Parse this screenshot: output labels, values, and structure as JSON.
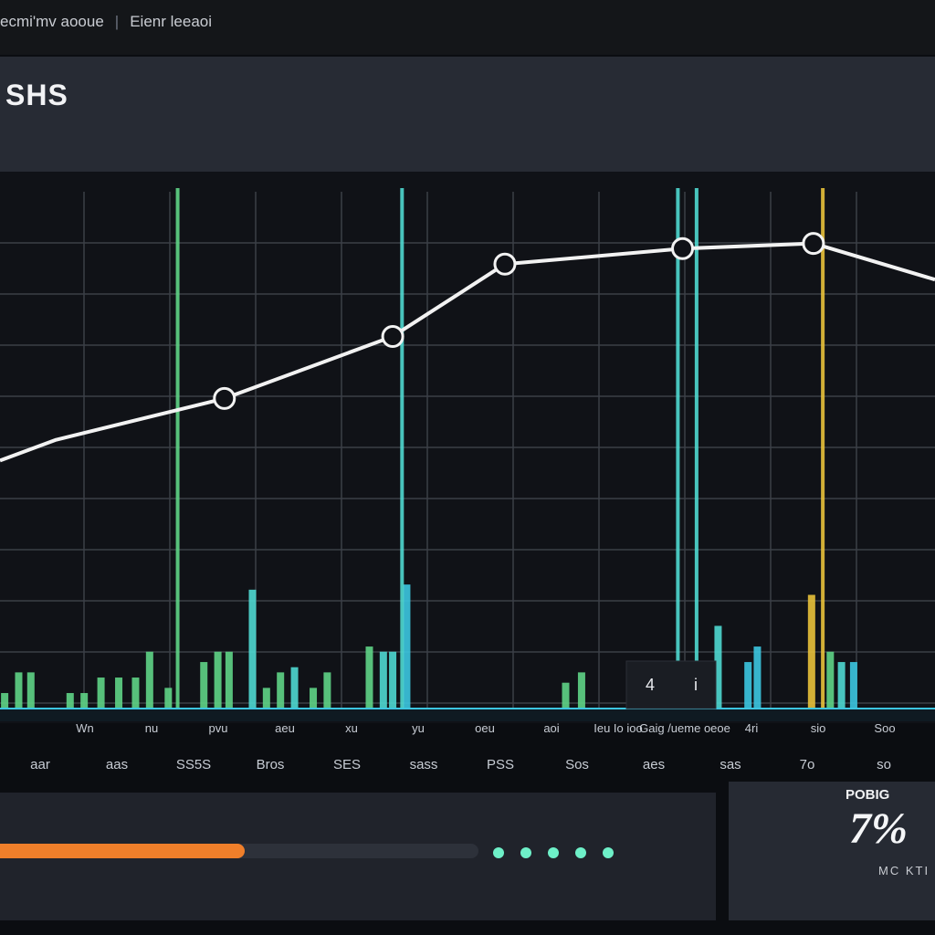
{
  "topbar": {
    "crumb_1": "ecmi'mv aooue",
    "crumb_2": "Eienr leeaoi",
    "separator": "|"
  },
  "header": {
    "title": "SHS"
  },
  "colors": {
    "line": "#f2f2f2",
    "green": "#5fd486",
    "teal": "#4fd8d0",
    "cyan": "#3cc6e0",
    "yellow": "#e8c13a",
    "grid": "#3b3f47",
    "accent_orange": "#f07f2a"
  },
  "chart_data": {
    "type": "line",
    "title": "",
    "xlabel": "",
    "ylabel": "",
    "grid": true,
    "xlim": [
      0,
      100
    ],
    "ylim": [
      0,
      100
    ],
    "series": [
      {
        "x": [
          0,
          6,
          24,
          42,
          54,
          73,
          87,
          100
        ],
        "values": [
          48,
          52,
          60,
          72,
          86,
          89,
          90,
          83
        ],
        "markers_at": [
          2,
          3,
          4,
          5,
          6
        ]
      }
    ],
    "vertical_markers": [
      {
        "x": 19,
        "color": "green"
      },
      {
        "x": 43,
        "color": "teal"
      },
      {
        "x": 72.5,
        "color": "teal"
      },
      {
        "x": 74.5,
        "color": "teal"
      },
      {
        "x": 88,
        "color": "yellow"
      }
    ],
    "bars": [
      {
        "x": 0.5,
        "value": 3,
        "color": "green"
      },
      {
        "x": 2,
        "value": 7,
        "color": "green"
      },
      {
        "x": 3.3,
        "value": 7,
        "color": "green"
      },
      {
        "x": 7.5,
        "value": 3,
        "color": "green"
      },
      {
        "x": 9,
        "value": 3,
        "color": "green"
      },
      {
        "x": 10.8,
        "value": 6,
        "color": "green"
      },
      {
        "x": 12.7,
        "value": 6,
        "color": "green"
      },
      {
        "x": 14.5,
        "value": 6,
        "color": "green"
      },
      {
        "x": 16,
        "value": 11,
        "color": "green"
      },
      {
        "x": 18,
        "value": 4,
        "color": "green"
      },
      {
        "x": 21.8,
        "value": 9,
        "color": "green"
      },
      {
        "x": 23.3,
        "value": 11,
        "color": "green"
      },
      {
        "x": 24.5,
        "value": 11,
        "color": "green"
      },
      {
        "x": 27,
        "value": 23,
        "color": "teal"
      },
      {
        "x": 28.5,
        "value": 4,
        "color": "green"
      },
      {
        "x": 30,
        "value": 7,
        "color": "green"
      },
      {
        "x": 31.5,
        "value": 8,
        "color": "teal"
      },
      {
        "x": 33.5,
        "value": 4,
        "color": "green"
      },
      {
        "x": 35,
        "value": 7,
        "color": "green"
      },
      {
        "x": 39.5,
        "value": 12,
        "color": "green"
      },
      {
        "x": 41,
        "value": 11,
        "color": "teal"
      },
      {
        "x": 42,
        "value": 11,
        "color": "teal"
      },
      {
        "x": 43.5,
        "value": 24,
        "color": "cyan"
      },
      {
        "x": 60.5,
        "value": 5,
        "color": "green"
      },
      {
        "x": 62.2,
        "value": 7,
        "color": "green"
      },
      {
        "x": 76.8,
        "value": 16,
        "color": "teal"
      },
      {
        "x": 80,
        "value": 9,
        "color": "cyan"
      },
      {
        "x": 81,
        "value": 12,
        "color": "cyan"
      },
      {
        "x": 86.8,
        "value": 22,
        "color": "yellow"
      },
      {
        "x": 88.8,
        "value": 11,
        "color": "green"
      },
      {
        "x": 90,
        "value": 9,
        "color": "teal"
      },
      {
        "x": 91.3,
        "value": 9,
        "color": "cyan"
      }
    ],
    "tick_labels_row1": [
      "",
      "Wn",
      "nu",
      "pvu",
      "aeu",
      "xu",
      "yu",
      "oeu",
      "aoi",
      "Ieu Io ioo",
      "Gaig /ueme oeoe",
      "4ri",
      "sio",
      "Soo"
    ],
    "tick_labels_row2": [
      "aar",
      "aas",
      "SS5S",
      "Bros",
      "SES",
      "sass",
      "PSS",
      "Sos",
      "aes",
      "sas",
      "7o",
      "so"
    ],
    "inset_glyphs": [
      "4",
      "i"
    ]
  },
  "progress": {
    "fraction": 0.5117
  },
  "dots": {
    "count": 5
  },
  "stat": {
    "label": "POBIG",
    "value": "7%",
    "sub": "MC KTI"
  }
}
